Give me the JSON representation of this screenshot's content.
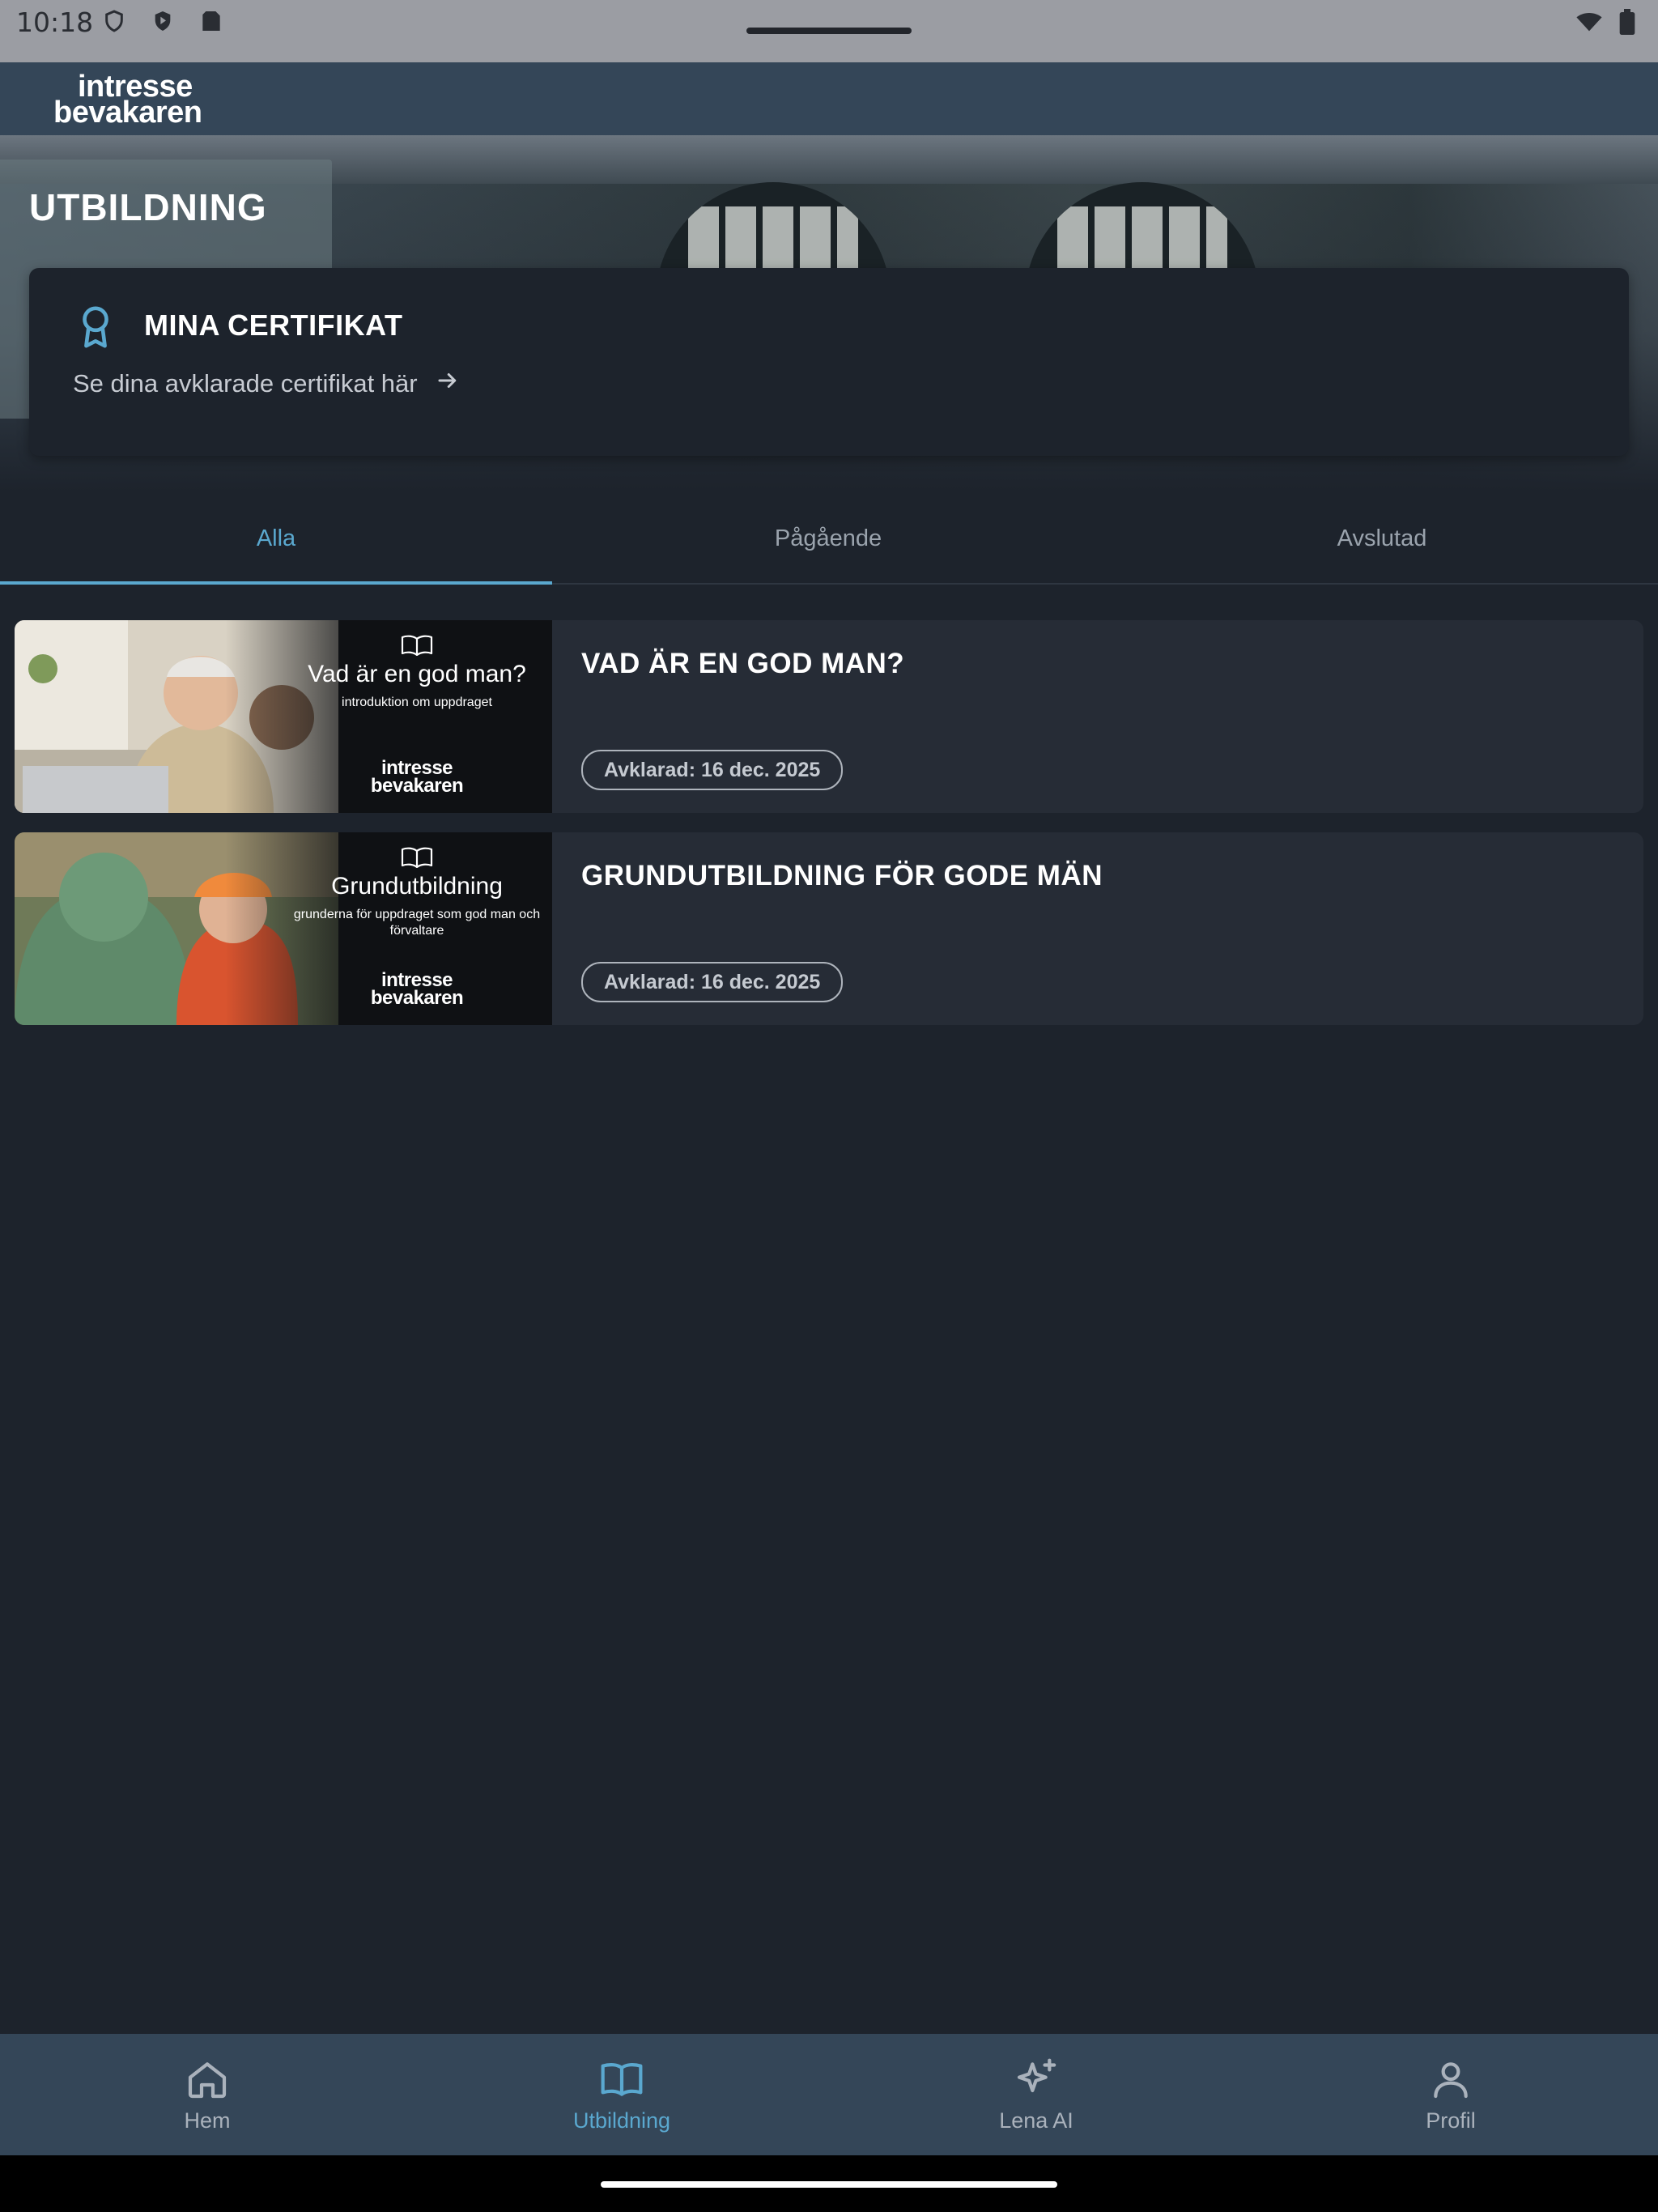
{
  "status": {
    "time": "10:18"
  },
  "brand": {
    "line1": "intresse",
    "line2": "bevakaren"
  },
  "hero": {
    "title": "UTBILDNING"
  },
  "certificates": {
    "title": "MINA CERTIFIKAT",
    "link_text": "Se dina avklarade certifikat här"
  },
  "tabs": [
    {
      "label": "Alla",
      "active": true
    },
    {
      "label": "Pågående",
      "active": false
    },
    {
      "label": "Avslutad",
      "active": false
    }
  ],
  "courses": [
    {
      "title": "VAD ÄR EN GOD MAN?",
      "thumb_heading": "Vad är en god man?",
      "thumb_sub": "introduktion om uppdraget",
      "badge": "Avklarad: 16 dec. 2025"
    },
    {
      "title": "GRUNDUTBILDNING FÖR GODE MÄN",
      "thumb_heading": "Grundutbildning",
      "thumb_sub": "grunderna för uppdraget som god man och förvaltare",
      "badge": "Avklarad: 16 dec. 2025"
    }
  ],
  "nav": [
    {
      "label": "Hem",
      "icon": "home-icon",
      "active": false
    },
    {
      "label": "Utbildning",
      "icon": "book-icon",
      "active": true
    },
    {
      "label": "Lena AI",
      "icon": "sparkle-icon",
      "active": false
    },
    {
      "label": "Profil",
      "icon": "person-icon",
      "active": false
    }
  ],
  "colors": {
    "accent": "#5aa8cf",
    "background": "#1d232c",
    "card": "#262c36",
    "bar": "#344658"
  }
}
